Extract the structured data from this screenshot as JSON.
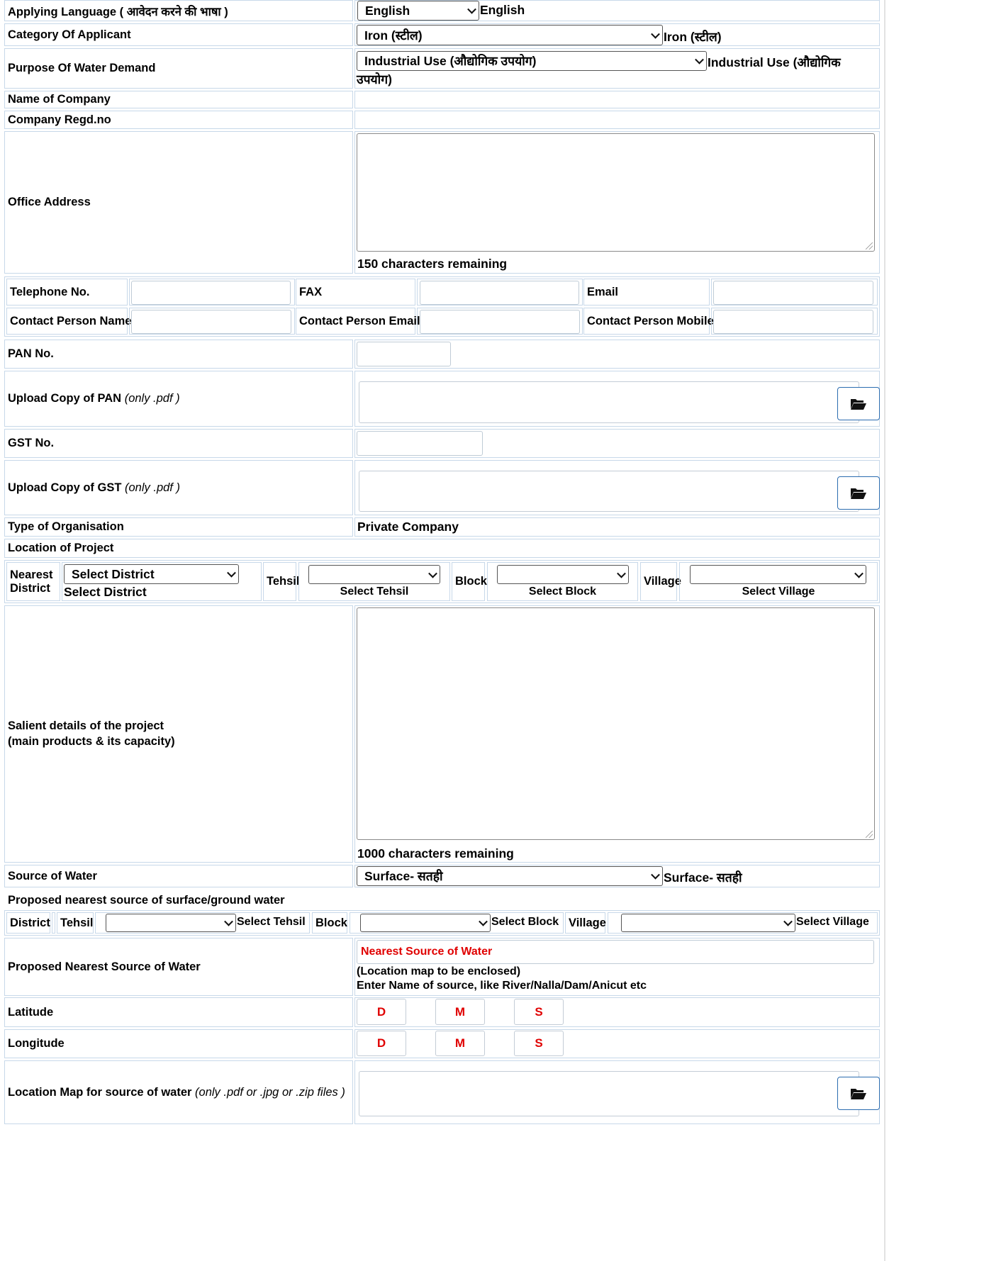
{
  "applying_language": {
    "label": "Applying Language ( आवेदन करने की भाषा )",
    "selected": "English",
    "echo": "English"
  },
  "category": {
    "label": "Category Of Applicant",
    "selected": "Iron (स्टील)",
    "echo": "Iron (स्टील)"
  },
  "purpose": {
    "label": "Purpose Of Water Demand",
    "selected": "Industrial Use (औद्योगिक उपयोग)",
    "echo_line1": "Industrial Use (औद्योगिक",
    "echo_line2": "उपयोग)"
  },
  "company_name": {
    "label": "Name of Company"
  },
  "company_regd": {
    "label": "Company Regd.no"
  },
  "office_address": {
    "label": "Office Address",
    "remaining": "150 characters remaining"
  },
  "contact": {
    "telephone_label": "Telephone No.",
    "fax_label": "FAX",
    "email_label": "Email",
    "person_name_label": "Contact Person Name",
    "person_email_label": "Contact Person Email",
    "person_mobile_label": "Contact Person Mobile"
  },
  "pan": {
    "label": "PAN No.",
    "upload_label": "Upload Copy of PAN",
    "upload_hint": "(only .pdf )"
  },
  "gst": {
    "label": "GST No.",
    "upload_label": "Upload Copy of GST",
    "upload_hint": "(only .pdf )"
  },
  "organisation": {
    "label": "Type of Organisation",
    "value": "Private Company"
  },
  "location": {
    "heading": "Location of Project",
    "district_label_1": "Nearest",
    "district_label_2": "District",
    "district_selected": "Select District",
    "district_echo": "Select District",
    "tehsil_label": "Tehsil",
    "tehsil_echo": "Select Tehsil",
    "block_label": "Block",
    "block_echo": "Select Block",
    "village_label": "Village",
    "village_echo": "Select Village"
  },
  "salient": {
    "label_1": "Salient details of the project",
    "label_2": "(main products & its capacity)",
    "remaining": "1000 characters remaining"
  },
  "source": {
    "label": "Source of Water",
    "selected": "Surface- सतही",
    "echo": "Surface- सतही"
  },
  "proposed_area": {
    "heading": "Proposed nearest source of surface/ground water",
    "district_label": "District",
    "tehsil_label": "Tehsil",
    "tehsil_echo": "Select Tehsil",
    "block_label": "Block",
    "block_echo": "Select Block",
    "village_label": "Village",
    "village_echo": "Select Village"
  },
  "nearest_source": {
    "label": "Proposed Nearest Source of Water",
    "placeholder": "Nearest Source of Water",
    "note_1": "(Location map to be enclosed)",
    "note_2": "Enter Name of source, like River/Nalla/Dam/Anicut etc"
  },
  "latitude": {
    "label": "Latitude",
    "d": "D",
    "m": "M",
    "s": "S"
  },
  "longitude": {
    "label": "Longitude",
    "d": "D",
    "m": "M",
    "s": "S"
  },
  "location_map": {
    "label": "Location Map for source of water",
    "hint": "(only .pdf or .jpg or .zip files )"
  },
  "icons": {
    "dropdown": "chevron-down-icon",
    "upload": "folder-open-icon"
  },
  "colors": {
    "border": "#c7d8e9",
    "required_red": "#e00000",
    "button_blue": "#2b6cb0"
  }
}
